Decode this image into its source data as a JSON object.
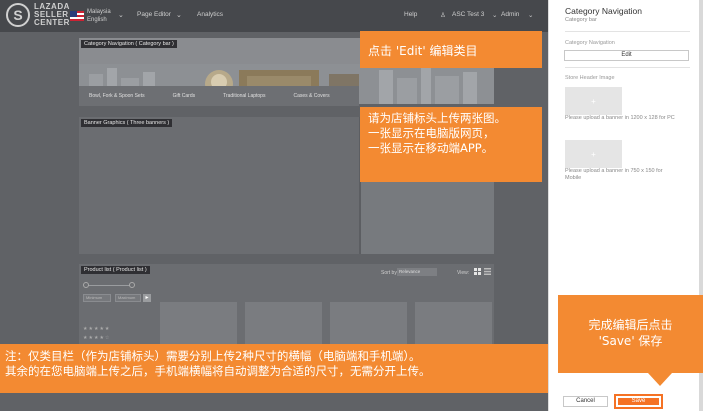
{
  "topbar": {
    "logo_mark": "S",
    "logo_line1": "LAZADA",
    "logo_line2": "SELLER",
    "logo_line3": "CENTER",
    "country": "Malaysia",
    "language": "English",
    "page_editor": "Page Editor",
    "analytics": "Analytics",
    "help": "Help",
    "account": "ASC Test 3",
    "admin": "Admin"
  },
  "canvas": {
    "header_section_label": "Category Navigation ( Category bar )",
    "categories": [
      "Bowl, Fork & Spoon Sets",
      "Gift Cards",
      "Traditional Laptops",
      "Cases & Covers"
    ],
    "banner_section_label": "Banner Graphics ( Three banners )",
    "product_section_label": "Product list ( Product list )",
    "sort_by_label": "Sort by:",
    "sort_by_value": "Relevance",
    "view_label": "View:",
    "min_placeholder": "Minimum",
    "max_placeholder": "Maximum",
    "go_label": "▸",
    "rating_full": "★★★★★",
    "rating_partial": "★★★★☆"
  },
  "side_panel": {
    "title": "Category Navigation",
    "subtitle": "Category bar",
    "nav_field_label": "Category Navigation",
    "edit_button": "Edit",
    "store_header_label": "Store Header Image",
    "upload_icon": "+",
    "pc_hint": "Please upload a banner in 1200 x 128 for PC",
    "mobile_hint": "Please upload a banner in 750 x 150 for Mobile",
    "cancel_button": "Cancel",
    "save_button": "Save"
  },
  "callouts": {
    "edit": "点击 'Edit' 编辑类目",
    "upload_line1": "请为店铺标头上传两张图。",
    "upload_line2": "一张显示在电脑版网页，",
    "upload_line3": "一张显示在移动端APP。",
    "save_line1": "完成编辑后点击",
    "save_line2": "'Save' 保存",
    "note_line1": "注：仅类目栏（作为店铺标头）需要分别上传2种尺寸的横幅（电脑端和手机端）。",
    "note_line2": "其余的在您电脑端上传之后，手机端横幅将自动调整为合适的尺寸，无需分开上传。"
  },
  "colors": {
    "accent_orange": "#f38a32",
    "save_orange": "#f57224"
  }
}
